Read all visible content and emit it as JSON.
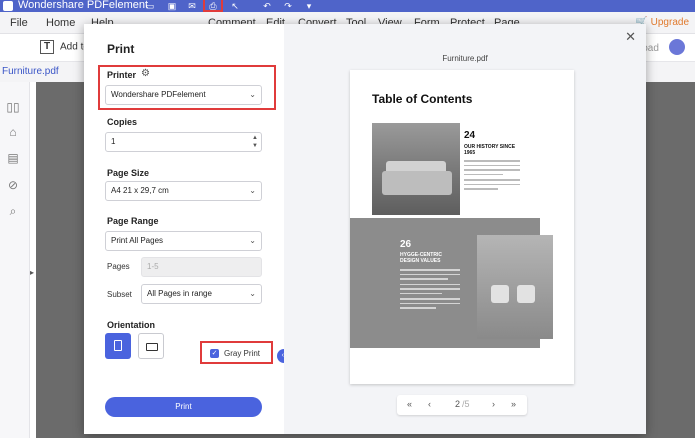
{
  "app": {
    "title": "Wondershare PDFelement"
  },
  "menu": {
    "items": [
      "File",
      "Home",
      "Help",
      "Comment",
      "Edit",
      "Convert",
      "Tool",
      "View",
      "Form",
      "Protect",
      "Page"
    ],
    "upgrade_label": "Upgrade"
  },
  "toolbar": {
    "add_text_label": "Add te",
    "load_label": "load"
  },
  "tab": {
    "name": "Furniture.pdf"
  },
  "dialog": {
    "title": "Print",
    "printer": {
      "label": "Printer",
      "value": "Wondershare PDFelement"
    },
    "copies": {
      "label": "Copies",
      "value": "1"
    },
    "page_size": {
      "label": "Page Size",
      "value": "A4 21 x 29,7 cm"
    },
    "page_range": {
      "label": "Page Range",
      "value": "Print All Pages",
      "pages_label": "Pages",
      "pages_placeholder": "1-5",
      "subset_label": "Subset",
      "subset_value": "All Pages in range"
    },
    "orientation": {
      "label": "Orientation",
      "selected": "portrait"
    },
    "gray_print": {
      "label": "Gray Print",
      "checked": true
    },
    "print_button": "Print"
  },
  "preview": {
    "file_name": "Furniture.pdf",
    "page_heading": "Table of Contents",
    "section1": {
      "number": "24",
      "title": "OUR HISTORY SINCE 1965"
    },
    "section2": {
      "number": "26",
      "title": "HYGGE-CENTRIC DESIGN VALUES"
    },
    "pager": {
      "first": "«",
      "prev": "‹",
      "current": "2",
      "total": "/5",
      "next": "›",
      "last": "»"
    }
  },
  "colors": {
    "accent": "#4a63de",
    "highlight": "#e03b3b",
    "titlebar": "#4f64c9",
    "upgrade": "#e07a2e"
  }
}
